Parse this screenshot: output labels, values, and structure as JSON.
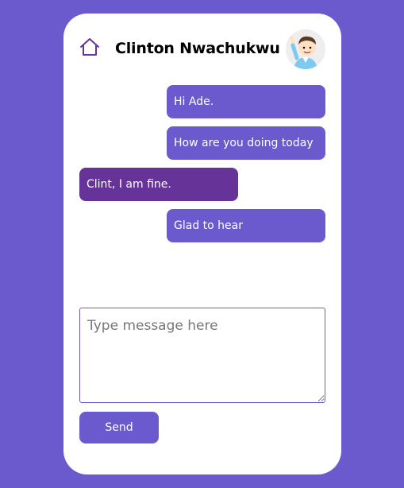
{
  "header": {
    "contact_name": "Clinton Nwachukwu",
    "home_icon": "home-icon",
    "avatar_icon": "cartoon-avatar"
  },
  "messages": [
    {
      "text": "Hi Ade.",
      "direction": "outgoing"
    },
    {
      "text": "How are you doing today",
      "direction": "outgoing"
    },
    {
      "text": "Clint, I am fine.",
      "direction": "incoming"
    },
    {
      "text": "Glad to hear",
      "direction": "outgoing"
    }
  ],
  "composer": {
    "placeholder": "Type message here",
    "value": ""
  },
  "send_label": "Send",
  "colors": {
    "background": "#6a5acd",
    "outgoing": "#6a5acd",
    "incoming": "#663399",
    "card": "#ffffff"
  }
}
